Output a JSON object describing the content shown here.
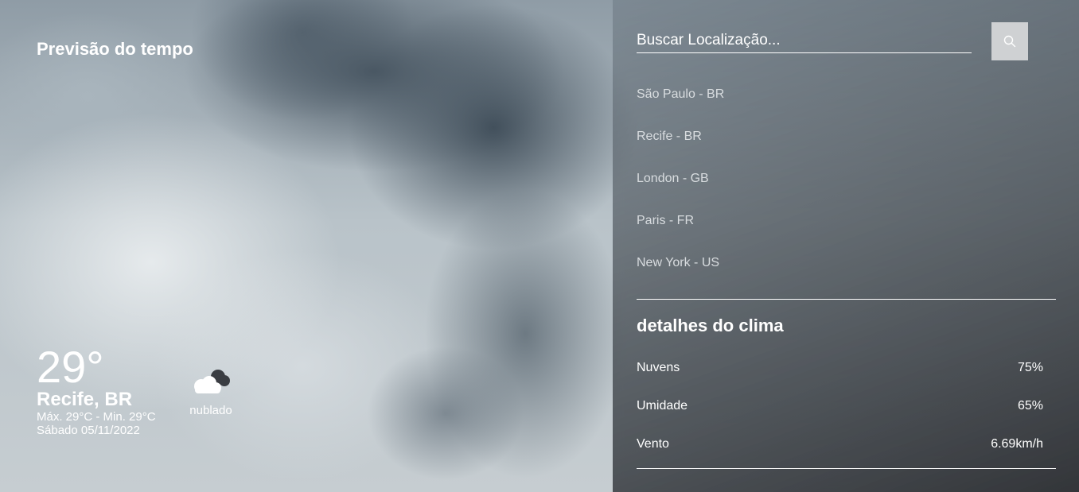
{
  "app": {
    "title": "Previsão do tempo"
  },
  "current": {
    "temperature": "29°",
    "location": "Recife, BR",
    "min_max": "Máx. 29°C - Min. 29°C",
    "date": "Sábado 05/11/2022",
    "condition": "nublado",
    "condition_icon": "cloudy-icon"
  },
  "search": {
    "placeholder": "Buscar Localização...",
    "button_icon": "search-icon"
  },
  "locations": [
    "São Paulo - BR",
    "Recife - BR",
    "London - GB",
    "Paris - FR",
    "New York - US"
  ],
  "details": {
    "title": "detalhes do clima",
    "rows": [
      {
        "label": "Nuvens",
        "value": "75%"
      },
      {
        "label": "Umidade",
        "value": "65%"
      },
      {
        "label": "Vento",
        "value": "6.69km/h"
      }
    ]
  },
  "colors": {
    "text": "#ffffff",
    "location_text": "#d8dcdf",
    "search_button": "#cfd1d3"
  }
}
